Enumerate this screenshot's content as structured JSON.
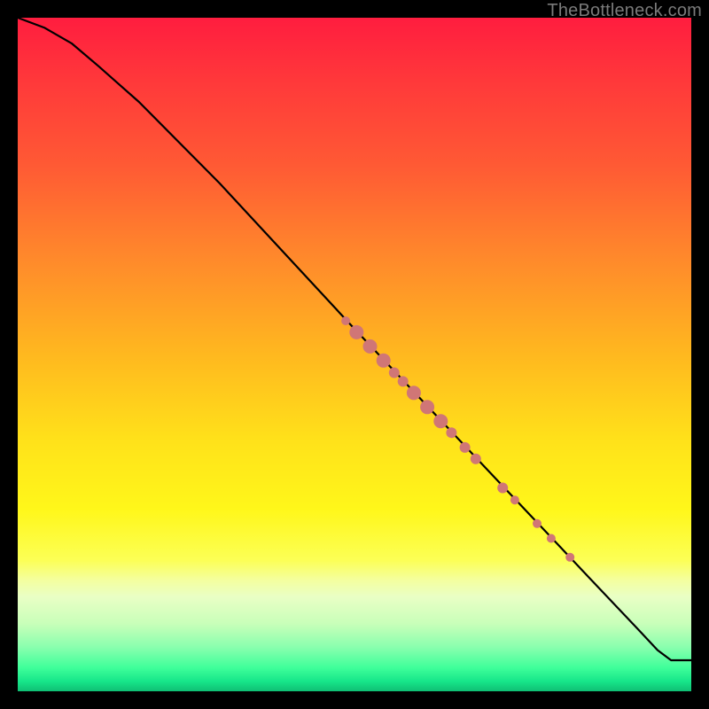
{
  "watermark": "TheBottleneck.com",
  "chart_data": {
    "type": "line",
    "title": "",
    "xlabel": "",
    "ylabel": "",
    "xlim": [
      0,
      100
    ],
    "ylim": [
      0,
      100
    ],
    "background_gradient": {
      "direction": "vertical",
      "stops": [
        {
          "pos": 0,
          "color": "#ff1d3f"
        },
        {
          "pos": 50,
          "color": "#ffe21a"
        },
        {
          "pos": 83,
          "color": "#f4ff9f"
        },
        {
          "pos": 97,
          "color": "#3fff9a"
        },
        {
          "pos": 100,
          "color": "#0fbf74"
        }
      ]
    },
    "series": [
      {
        "name": "curve",
        "x": [
          0,
          4,
          8,
          12,
          18,
          30,
          50,
          70,
          85,
          92,
          95,
          97,
          100
        ],
        "y": [
          100,
          98.5,
          96.2,
          92.8,
          87.5,
          75.4,
          53.8,
          32.6,
          16.7,
          9.3,
          6.1,
          4.6,
          4.6
        ]
      }
    ],
    "marker_points": [
      {
        "x": 48.7,
        "y": 55.0,
        "r": 5
      },
      {
        "x": 50.3,
        "y": 53.3,
        "r": 8
      },
      {
        "x": 52.3,
        "y": 51.2,
        "r": 8
      },
      {
        "x": 54.3,
        "y": 49.1,
        "r": 8
      },
      {
        "x": 55.9,
        "y": 47.3,
        "r": 6
      },
      {
        "x": 57.2,
        "y": 46.0,
        "r": 6
      },
      {
        "x": 58.8,
        "y": 44.3,
        "r": 8
      },
      {
        "x": 60.8,
        "y": 42.2,
        "r": 8
      },
      {
        "x": 62.8,
        "y": 40.1,
        "r": 8
      },
      {
        "x": 64.4,
        "y": 38.4,
        "r": 6
      },
      {
        "x": 66.4,
        "y": 36.2,
        "r": 6
      },
      {
        "x": 68.0,
        "y": 34.5,
        "r": 6
      },
      {
        "x": 72.0,
        "y": 30.2,
        "r": 6
      },
      {
        "x": 73.8,
        "y": 28.4,
        "r": 5
      },
      {
        "x": 77.1,
        "y": 24.9,
        "r": 5
      },
      {
        "x": 79.2,
        "y": 22.7,
        "r": 5
      },
      {
        "x": 82.0,
        "y": 19.9,
        "r": 5
      }
    ]
  }
}
